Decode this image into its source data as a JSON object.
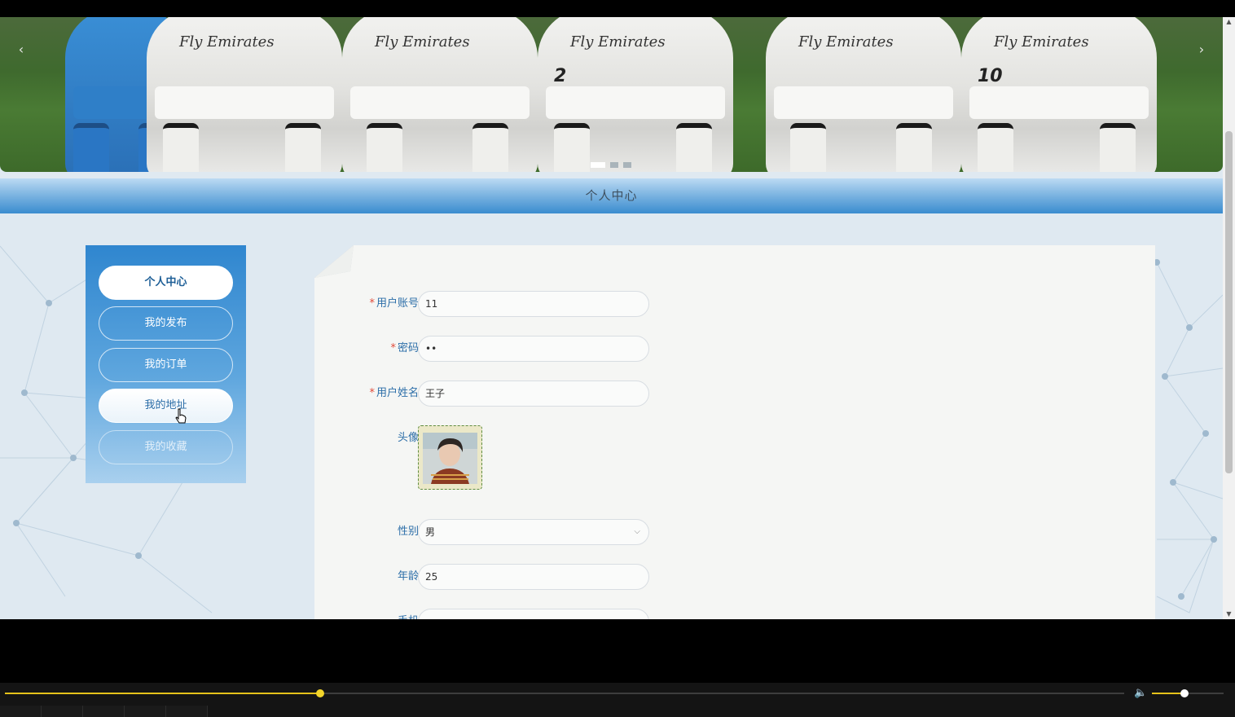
{
  "banner": {
    "prev_label": "‹",
    "next_label": "›",
    "slides": 3,
    "active_slide": 1,
    "jersey_text": "Fly Emirates",
    "numbers": [
      "2",
      "10"
    ]
  },
  "header": {
    "title": "个人中心"
  },
  "sidebar": {
    "items": [
      {
        "label": "个人中心",
        "state": "active"
      },
      {
        "label": "我的发布",
        "state": "normal"
      },
      {
        "label": "我的订单",
        "state": "normal"
      },
      {
        "label": "我的地址",
        "state": "hover"
      },
      {
        "label": "我的收藏",
        "state": "faded"
      }
    ]
  },
  "form": {
    "account": {
      "label": "用户账号",
      "required": "*",
      "value": "11"
    },
    "password": {
      "label": "密码",
      "required": "*",
      "value": "••"
    },
    "name": {
      "label": "用户姓名",
      "required": "*",
      "value": "王子"
    },
    "avatar": {
      "label": "头像"
    },
    "gender": {
      "label": "性别",
      "value": "男"
    },
    "age": {
      "label": "年龄",
      "value": "25"
    },
    "phone": {
      "label": "手机"
    }
  },
  "media_bar": {
    "progress": 0.282,
    "volume": 0.45,
    "colors": {
      "accent": "#e5c21a"
    }
  }
}
